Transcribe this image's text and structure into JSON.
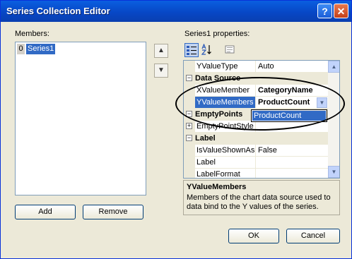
{
  "window": {
    "title": "Series Collection Editor",
    "help_glyph": "?",
    "close_glyph": "✕"
  },
  "members": {
    "label": "Members:",
    "items": [
      {
        "index": "0",
        "name": "Series1"
      }
    ],
    "add_label": "Add",
    "remove_label": "Remove"
  },
  "properties": {
    "label": "Series1 properties:",
    "rows": [
      {
        "kind": "prop",
        "name": "YValueType",
        "value": "Auto"
      },
      {
        "kind": "category",
        "name": "Data Source",
        "expander": "−"
      },
      {
        "kind": "prop",
        "name": "XValueMember",
        "value": "CategoryName"
      },
      {
        "kind": "prop",
        "name": "YValueMembers",
        "value": "ProductCount"
      },
      {
        "kind": "category",
        "name": "EmptyPoints",
        "expander": "−"
      },
      {
        "kind": "prop",
        "name": "EmptyPointStyle",
        "value": "",
        "expander": "+"
      },
      {
        "kind": "category",
        "name": "Label",
        "expander": "−"
      },
      {
        "kind": "prop",
        "name": "IsValueShownAsL",
        "value": "False"
      },
      {
        "kind": "prop",
        "name": "Label",
        "value": ""
      },
      {
        "kind": "prop",
        "name": "LabelFormat",
        "value": ""
      }
    ],
    "dropdown_option": "ProductCount",
    "description_title": "YValueMembers",
    "description_text": "Members of the chart data source used to data bind to the Y values of the series."
  },
  "buttons": {
    "ok_label": "OK",
    "cancel_label": "Cancel"
  },
  "colors": {
    "title_bar": "#0747c6",
    "selection": "#316ac5",
    "dialog_bg": "#ece9d8"
  }
}
